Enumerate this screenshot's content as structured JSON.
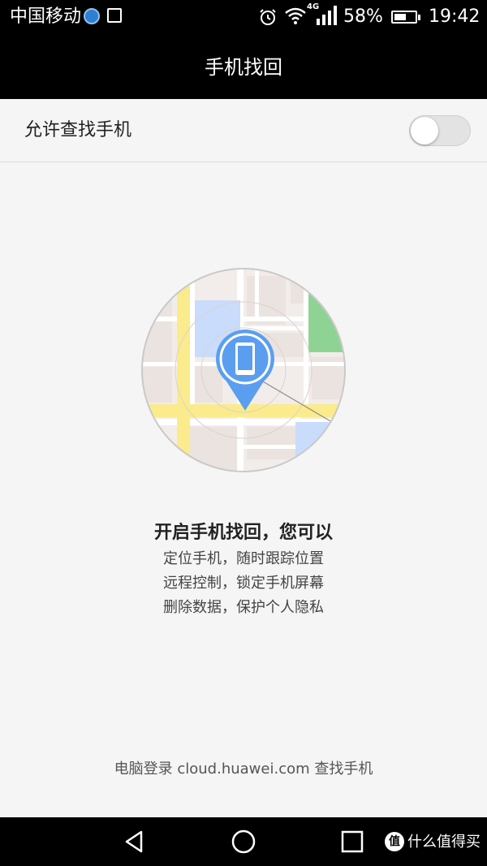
{
  "status_bar": {
    "carrier": "中国移动",
    "network_type": "4G",
    "battery_percent": "58%",
    "time": "19:42",
    "icons": [
      "app-notification-icon",
      "image-icon",
      "alarm-icon",
      "wifi-icon",
      "signal-icon",
      "battery-icon"
    ]
  },
  "header": {
    "title": "手机找回"
  },
  "setting": {
    "label": "允许查找手机",
    "toggle_state": "off"
  },
  "promo": {
    "heading": "开启手机找回，您可以",
    "lines": [
      "定位手机，随时跟踪位置",
      "远程控制，锁定手机屏幕",
      "删除数据，保护个人隐私"
    ]
  },
  "footer": {
    "link_text": "电脑登录 cloud.huawei.com 查找手机"
  },
  "nav_bar": {
    "icons": [
      "back-icon",
      "home-icon",
      "recent-apps-icon"
    ]
  },
  "watermark": {
    "badge": "值",
    "text": "什么值得买"
  },
  "colors": {
    "pin": "#5b9ef0",
    "map_road": "#fbeb8c",
    "map_block": "#efe8e4",
    "map_water": "#c9dcfb",
    "map_park": "#8fd394"
  }
}
